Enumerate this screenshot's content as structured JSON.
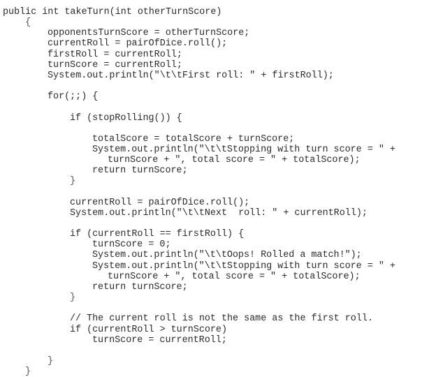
{
  "document": {
    "language": "Java",
    "lines": [
      {
        "indent": 0,
        "text": "public int takeTurn(int otherTurnScore)"
      },
      {
        "indent": 1,
        "text": "{"
      },
      {
        "indent": 2,
        "text": "opponentsTurnScore = otherTurnScore;"
      },
      {
        "indent": 2,
        "text": "currentRoll = pairOfDice.roll();"
      },
      {
        "indent": 2,
        "text": "firstRoll = currentRoll;"
      },
      {
        "indent": 2,
        "text": "turnScore = currentRoll;"
      },
      {
        "indent": 2,
        "text": "System.out.println(\"\\t\\tFirst roll: \" + firstRoll);"
      },
      {
        "indent": 0,
        "text": ""
      },
      {
        "indent": 2,
        "text": "for(;;) {"
      },
      {
        "indent": 0,
        "text": ""
      },
      {
        "indent": 3,
        "text": "if (stopRolling()) {"
      },
      {
        "indent": 0,
        "text": ""
      },
      {
        "indent": 4,
        "text": "totalScore = totalScore + turnScore;"
      },
      {
        "indent": 4,
        "text": "System.out.println(\"\\t\\tStopping with turn score = \" +"
      },
      {
        "indent": 5,
        "text": "turnScore + \", total score = \" + totalScore);"
      },
      {
        "indent": 4,
        "text": "return turnScore;"
      },
      {
        "indent": 3,
        "text": "}"
      },
      {
        "indent": 0,
        "text": ""
      },
      {
        "indent": 3,
        "text": "currentRoll = pairOfDice.roll();"
      },
      {
        "indent": 3,
        "text": "System.out.println(\"\\t\\tNext  roll: \" + currentRoll);"
      },
      {
        "indent": 0,
        "text": ""
      },
      {
        "indent": 3,
        "text": "if (currentRoll == firstRoll) {"
      },
      {
        "indent": 4,
        "text": "turnScore = 0;"
      },
      {
        "indent": 4,
        "text": "System.out.println(\"\\t\\tOops! Rolled a match!\");"
      },
      {
        "indent": 4,
        "text": "System.out.println(\"\\t\\tStopping with turn score = \" +"
      },
      {
        "indent": 5,
        "text": "turnScore + \", total score = \" + totalScore);"
      },
      {
        "indent": 4,
        "text": "return turnScore;"
      },
      {
        "indent": 3,
        "text": "}"
      },
      {
        "indent": 0,
        "text": ""
      },
      {
        "indent": 3,
        "text": "// The current roll is not the same as the first roll."
      },
      {
        "indent": 3,
        "text": "if (currentRoll > turnScore)"
      },
      {
        "indent": 4,
        "text": "turnScore = currentRoll;"
      },
      {
        "indent": 0,
        "text": ""
      },
      {
        "indent": 2,
        "text": "}"
      },
      {
        "indent": 1,
        "text": "}"
      }
    ]
  }
}
